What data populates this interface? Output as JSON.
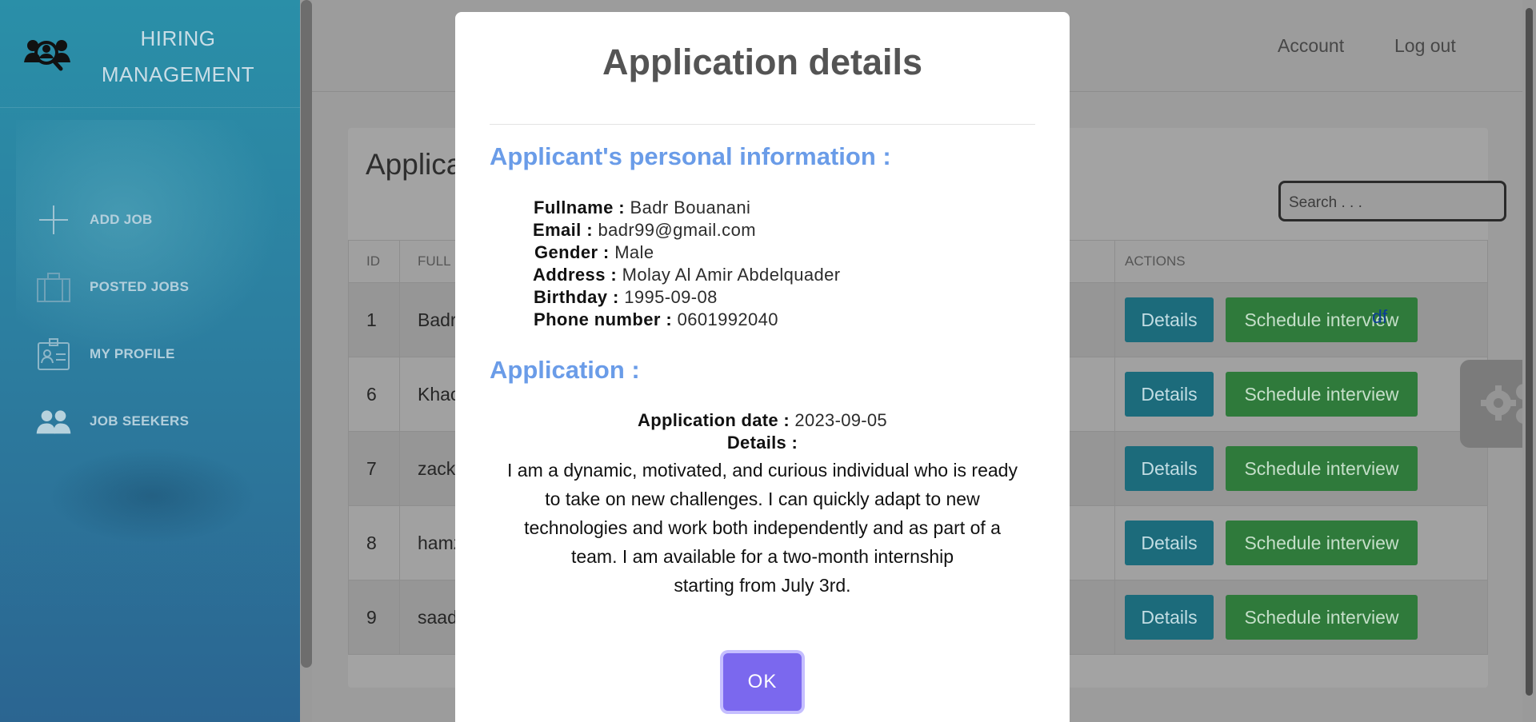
{
  "sidebar": {
    "brand_line1": "HIRING",
    "brand_line2": "MANAGEMENT",
    "brand_icon": "team-search-icon",
    "items": [
      {
        "label": "ADD JOB",
        "icon": "plus-icon"
      },
      {
        "label": "POSTED JOBS",
        "icon": "briefcase-icon"
      },
      {
        "label": "MY PROFILE",
        "icon": "id-card-icon"
      },
      {
        "label": "JOB SEEKERS",
        "icon": "users-icon"
      }
    ]
  },
  "header": {
    "account_link": "Account",
    "logout_link": "Log out"
  },
  "page": {
    "title_partial": "Applica",
    "search_placeholder": "Search . . ."
  },
  "table": {
    "headers": {
      "id": "ID",
      "full_name_partial": "FULL N",
      "actions": "ACTIONS"
    },
    "rows": [
      {
        "id": "1",
        "name_partial": "Badr"
      },
      {
        "id": "6",
        "name_partial": "Khao"
      },
      {
        "id": "7",
        "name_partial": "zacka"
      },
      {
        "id": "8",
        "name_partial": "hamz"
      },
      {
        "id": "9",
        "name_partial": "saad"
      }
    ],
    "link_fragment": "df",
    "details_label": "Details",
    "schedule_label": "Schedule interview"
  },
  "modal": {
    "title": "Application details",
    "personal_heading": "Applicant's personal information :",
    "personal": {
      "fullname_label": "Fullname :",
      "fullname": "Badr Bouanani",
      "email_label": "Email :",
      "email": "badr99@gmail.com",
      "gender_label": "Gender :",
      "gender": "Male",
      "address_label": "Address :",
      "address": "Molay Al Amir Abdelquader",
      "birthday_label": "Birthday :",
      "birthday": "1995-09-08",
      "phone_label": "Phone number :",
      "phone": "0601992040"
    },
    "application_heading": "Application :",
    "application_date_label": "Application date :",
    "application_date": "2023-09-05",
    "details_label": "Details :",
    "details_lines": [
      "I am a dynamic, motivated, and curious individual who is ready",
      "to take on new challenges. I can quickly adapt to new",
      "technologies and work both independently and as part of a",
      "team. I am available for a two-month internship",
      "starting from July 3rd."
    ],
    "ok_label": "OK"
  },
  "colors": {
    "sidebar_top": "#2a8fa8",
    "sidebar_bottom": "#2b6591",
    "section_heading": "#6a9ce8",
    "ok_button": "#7b68ee",
    "details_button": "#1c6b7b",
    "schedule_button": "#2f7a3b"
  }
}
